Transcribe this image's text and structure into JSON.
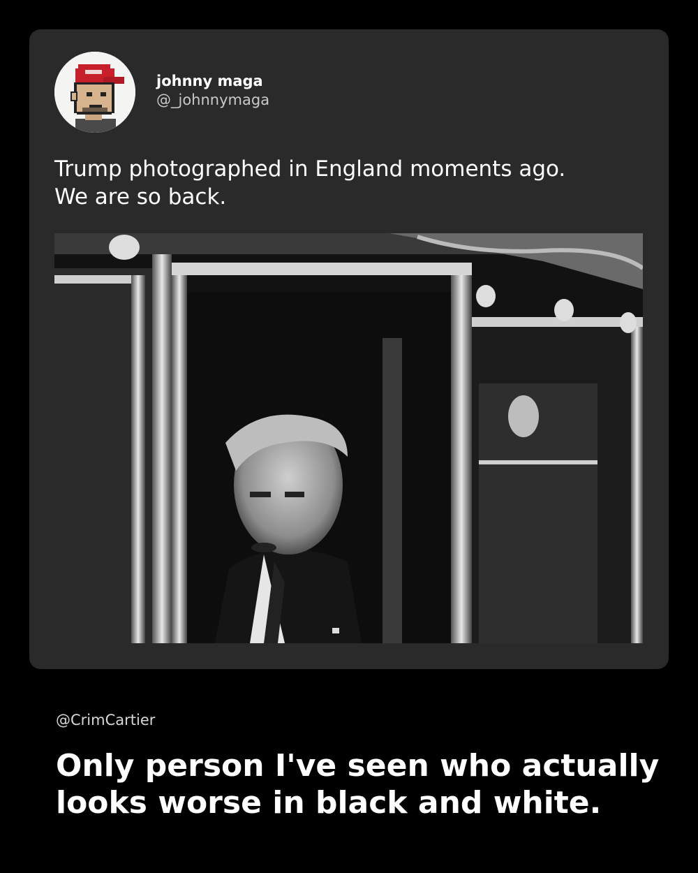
{
  "post": {
    "author": {
      "display_name": "johnny maga",
      "handle": "@_johnnymaga",
      "avatar": "pixel-art-avatar-red-cap-icon"
    },
    "text_lines": [
      "Trump photographed in England moments ago.",
      "We are so back."
    ],
    "photo": "black-and-white-photo-man-in-carriage-window"
  },
  "meme": {
    "credit": "@CrimCartier",
    "caption_lines": [
      "Only person I've seen who actually",
      "looks worse in black and white."
    ]
  },
  "colors": {
    "page_background": "#000000",
    "card_background": "#2a2a2a",
    "text_primary": "#ffffff",
    "text_secondary": "#c9c9c9",
    "cap_red": "#c8202a"
  }
}
